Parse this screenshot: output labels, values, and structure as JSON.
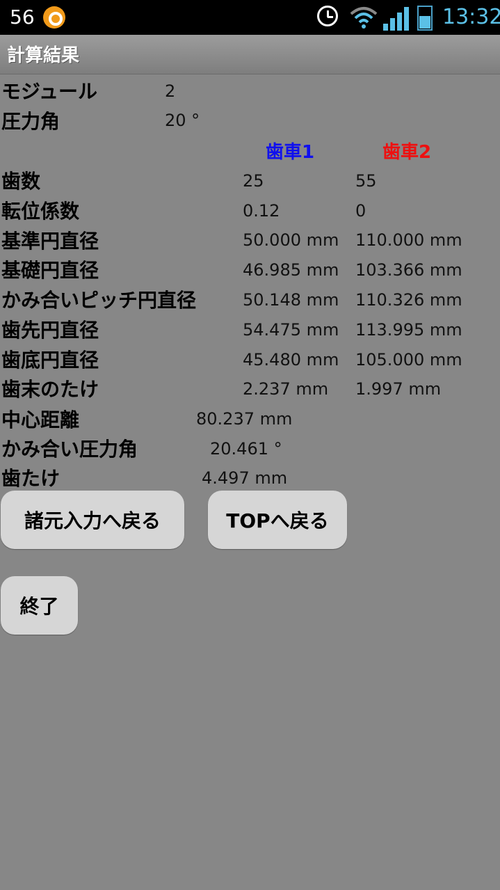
{
  "status": {
    "notification_count": "56",
    "time": "13:32"
  },
  "titlebar": {
    "title": "計算結果"
  },
  "params": {
    "module_label": "モジュール",
    "module_value": "2",
    "pressure_angle_label": "圧力角",
    "pressure_angle_value": "20 °"
  },
  "columns": {
    "gear1": "歯車1",
    "gear2": "歯車2",
    "gear1_color": "#1010ee",
    "gear2_color": "#ee1010"
  },
  "rows": [
    {
      "label": "歯数",
      "g1": "25",
      "g2": "55"
    },
    {
      "label": "転位係数",
      "g1": "0.12",
      "g2": "0"
    },
    {
      "label": "基準円直径",
      "g1": "50.000 mm",
      "g2": "110.000 mm"
    },
    {
      "label": "基礎円直径",
      "g1": "46.985 mm",
      "g2": "103.366 mm"
    },
    {
      "label": "かみ合いピッチ円直径",
      "g1": "50.148 mm",
      "g2": "110.326 mm"
    },
    {
      "label": "歯先円直径",
      "g1": "54.475 mm",
      "g2": "113.995 mm"
    },
    {
      "label": "歯底円直径",
      "g1": "45.480 mm",
      "g2": "105.000 mm"
    },
    {
      "label": "歯末のたけ",
      "g1": "2.237 mm",
      "g2": "1.997 mm"
    }
  ],
  "results": [
    {
      "label": "中心距離",
      "value": "80.237 mm"
    },
    {
      "label": "かみ合い圧力角",
      "value": "20.461 °"
    },
    {
      "label": "歯たけ",
      "value": "4.497 mm"
    }
  ],
  "buttons": {
    "back_to_input": "諸元入力へ戻る",
    "back_to_top": "TOPへ戻る",
    "exit": "終了"
  }
}
